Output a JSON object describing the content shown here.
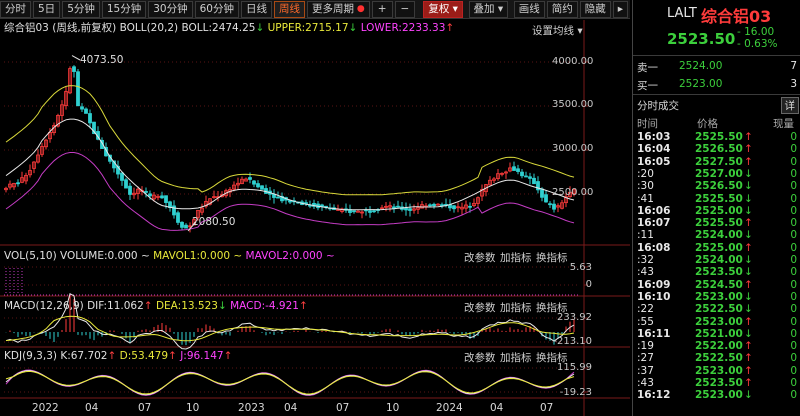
{
  "toolbar": {
    "items": [
      "分时",
      "5日",
      "5分钟",
      "15分钟",
      "30分钟",
      "60分钟",
      "日线",
      "周线",
      "更多周期",
      "复权",
      "叠加",
      "画线",
      "简约",
      "隐藏"
    ],
    "active_index": 7,
    "red_index": 9,
    "plus": "+",
    "minus": "−",
    "right_arrow": "▸"
  },
  "main_panel": {
    "title": "综合铝03",
    "indicator": "(周线,前复权)",
    "boll_label": "BOLL(20,2)",
    "boll_value": "BOLL:2474.25",
    "upper_value": "UPPER:2715.17",
    "lower_value": "LOWER:2233.33",
    "settings": "设置均线",
    "high_mark": "4073.50",
    "low_mark": "2080.50",
    "y_ticks": [
      "4000.00",
      "3500.00",
      "3000.00",
      "2500.00"
    ]
  },
  "vol_panel": {
    "label": "VOL(5,10)",
    "volume": "VOLUME:0.000",
    "mavol1": "MAVOL1:0.000",
    "mavol2": "MAVOL2:0.000",
    "tools": [
      "改参数",
      "加指标",
      "换指标"
    ],
    "y_ticks": [
      "5.63",
      "0"
    ]
  },
  "macd_panel": {
    "label": "MACD(12,26,9)",
    "dif": "DIF:11.062",
    "dea": "DEA:13.523",
    "macd": "MACD:-4.921",
    "tools": [
      "改参数",
      "加指标",
      "换指标"
    ],
    "y_ticks": [
      "233.92",
      "-213.10"
    ]
  },
  "kdj_panel": {
    "label": "KDJ(9,3,3)",
    "k": "K:67.702",
    "d": "D:53.479",
    "j": "J:96.147",
    "tools": [
      "改参数",
      "加指标",
      "换指标"
    ],
    "y_ticks": [
      "115.99",
      "-19.23"
    ]
  },
  "x_ticks": [
    "2022",
    "04",
    "07",
    "10",
    "2023",
    "04",
    "07",
    "10",
    "2024",
    "04",
    "07"
  ],
  "side": {
    "code": "LALT",
    "name": "综合铝03",
    "price": "2523.50",
    "change": "- 16.00",
    "change_pct": "- 0.63%",
    "sell_label": "卖一",
    "sell_price": "2524.00",
    "sell_vol": "7",
    "buy_label": "买一",
    "buy_price": "2523.00",
    "buy_vol": "3",
    "tick_title": "分时成交",
    "detail_button": "详",
    "col_time": "时间",
    "col_price": "价格",
    "col_vol": "现量",
    "ticks": [
      {
        "t": "16:03",
        "p": "2525.50",
        "d": "↑"
      },
      {
        "t": "16:04",
        "p": "2526.50",
        "d": "↑"
      },
      {
        "t": "16:05",
        "p": "2527.50",
        "d": "↑"
      },
      {
        "t": ":20",
        "p": "2527.00",
        "d": "↓"
      },
      {
        "t": ":30",
        "p": "2526.50",
        "d": "↓"
      },
      {
        "t": ":41",
        "p": "2525.50",
        "d": "↓"
      },
      {
        "t": "16:06",
        "p": "2525.00",
        "d": "↓"
      },
      {
        "t": "16:07",
        "p": "2525.50",
        "d": "↑"
      },
      {
        "t": ":11",
        "p": "2524.00",
        "d": "↓"
      },
      {
        "t": "16:08",
        "p": "2525.00",
        "d": "↑"
      },
      {
        "t": ":32",
        "p": "2524.00",
        "d": "↓"
      },
      {
        "t": ":43",
        "p": "2523.50",
        "d": "↓"
      },
      {
        "t": "16:09",
        "p": "2524.50",
        "d": "↑"
      },
      {
        "t": "16:10",
        "p": "2523.00",
        "d": "↓"
      },
      {
        "t": ":22",
        "p": "2522.50",
        "d": "↓"
      },
      {
        "t": ":55",
        "p": "2523.00",
        "d": "↑"
      },
      {
        "t": "16:11",
        "p": "2521.00",
        "d": "↓"
      },
      {
        "t": ":19",
        "p": "2522.00",
        "d": "↑"
      },
      {
        "t": ":27",
        "p": "2522.50",
        "d": "↑"
      },
      {
        "t": ":37",
        "p": "2523.00",
        "d": "↑"
      },
      {
        "t": ":43",
        "p": "2523.50",
        "d": "↑"
      },
      {
        "t": "16:12",
        "p": "2523.00",
        "d": "↓"
      }
    ]
  },
  "colors": {
    "up": "#ff3b3b",
    "down": "#2fd0d0",
    "upper": "#d8d83a",
    "mid": "#e8e8e8",
    "lower": "#c43cc4",
    "green": "#3ccf3c"
  }
}
